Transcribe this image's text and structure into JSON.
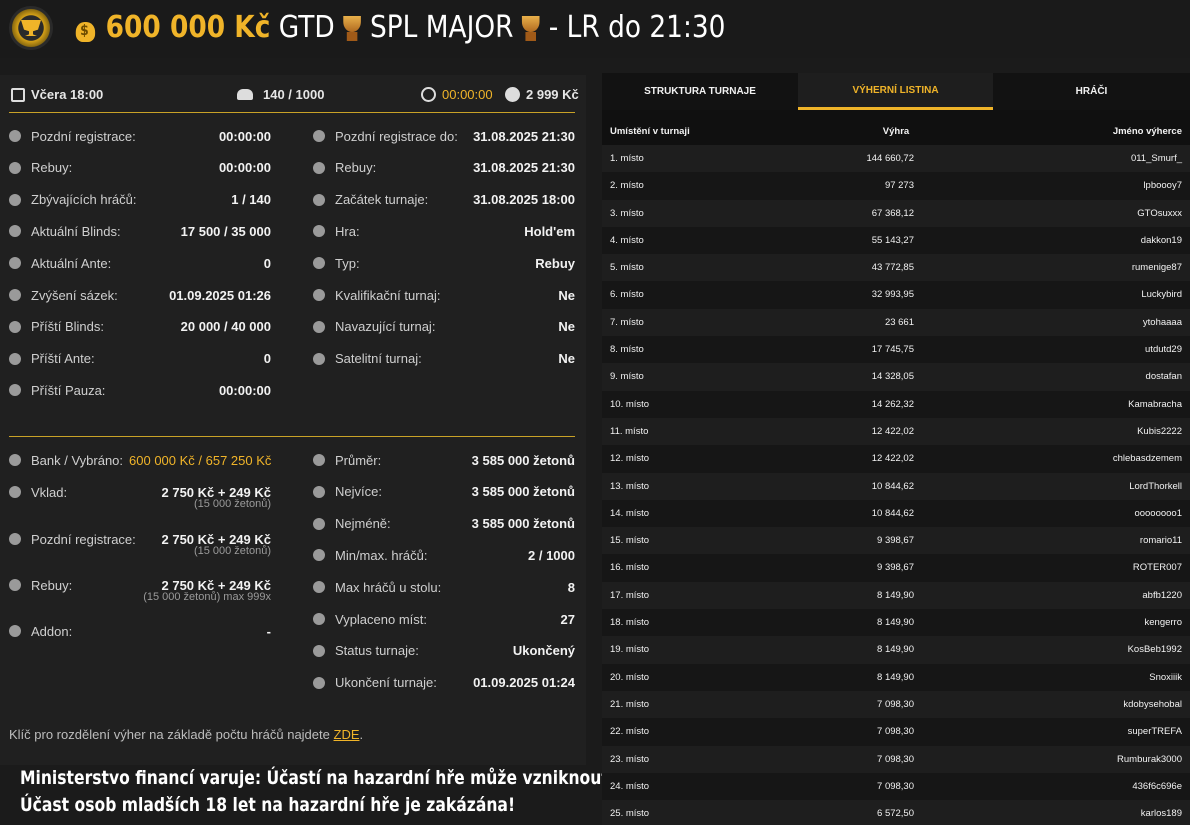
{
  "header": {
    "amount": "600 000 Kč",
    "gtd": "GTD",
    "event": "SPL MAJOR",
    "suffix": "- LR do 21:30"
  },
  "topbar": {
    "date": "Včera 18:00",
    "players": "140 / 1000",
    "timer": "00:00:00",
    "buyin": "2 999 Kč"
  },
  "info_left": [
    {
      "label": "Pozdní registrace:",
      "value": "00:00:00",
      "icon": "user-plus-icon"
    },
    {
      "label": "Rebuy:",
      "value": "00:00:00",
      "icon": "chips-icon"
    },
    {
      "label": "Zbývajících hráčů:",
      "value": "1 / 140",
      "icon": "users-icon"
    },
    {
      "label": "Aktuální Blinds:",
      "value": "17 500 / 35 000",
      "icon": "blinds-icon"
    },
    {
      "label": "Aktuální Ante:",
      "value": "0",
      "icon": "ante-icon"
    },
    {
      "label": "Zvýšení sázek:",
      "value": "01.09.2025 01:26",
      "icon": "level-up-icon"
    },
    {
      "label": "Příští Blinds:",
      "value": "20 000 / 40 000",
      "icon": "blinds-icon"
    },
    {
      "label": "Příští Ante:",
      "value": "0",
      "icon": "ante-icon"
    },
    {
      "label": "Příští Pauza:",
      "value": "00:00:00",
      "icon": "clock-icon"
    }
  ],
  "info_right": [
    {
      "label": "Pozdní registrace do:",
      "value": "31.08.2025 21:30",
      "icon": "user-plus-icon"
    },
    {
      "label": "Rebuy:",
      "value": "31.08.2025 21:30",
      "icon": "chips-icon"
    },
    {
      "label": "Začátek turnaje:",
      "value": "31.08.2025 18:00",
      "icon": "flag-icon"
    },
    {
      "label": "Hra:",
      "value": "Hold'em",
      "icon": "cards-icon"
    },
    {
      "label": "Typ:",
      "value": "Rebuy",
      "icon": "type-icon"
    },
    {
      "label": "Kvalifikační turnaj:",
      "value": "Ne",
      "icon": "medal-icon"
    },
    {
      "label": "Navazující turnaj:",
      "value": "Ne",
      "icon": "medal-icon"
    },
    {
      "label": "Satelitní turnaj:",
      "value": "Ne",
      "icon": "medal-icon"
    }
  ],
  "bank_left": [
    {
      "label": "Bank / Vybráno:",
      "value": "600 000 Kč / 657 250 Kč",
      "sub": "",
      "icon": "money-bag-icon"
    },
    {
      "label": "Vklad:",
      "value": "2 750 Kč + 249 Kč",
      "sub": "(15 000 žetonů)",
      "icon": "chips-icon"
    },
    {
      "label": "Pozdní registrace:",
      "value": "2 750 Kč + 249 Kč",
      "sub": "(15 000 žetonů)",
      "icon": "coin-icon"
    },
    {
      "label": "Rebuy:",
      "value": "2 750 Kč + 249 Kč",
      "sub": "(15 000 žetonů) max 999x",
      "icon": "chips-icon"
    },
    {
      "label": "Addon:",
      "value": "-",
      "sub": "",
      "icon": "coin-icon"
    }
  ],
  "bank_right": [
    {
      "label": "Průměr:",
      "value": "3 585 000 žetonů",
      "icon": "chip-icon"
    },
    {
      "label": "Nejvíce:",
      "value": "3 585 000 žetonů",
      "icon": "chip-up-icon"
    },
    {
      "label": "Nejméně:",
      "value": "3 585 000 žetonů",
      "icon": "chip-down-icon"
    },
    {
      "label": "Min/max. hráčů:",
      "value": "2 / 1000",
      "icon": "users-icon"
    },
    {
      "label": "Max hráčů u stolu:",
      "value": "8",
      "icon": "table-icon"
    },
    {
      "label": "Vyplaceno míst:",
      "value": "27",
      "icon": "payout-icon"
    },
    {
      "label": "Status turnaje:",
      "value": "Ukončený",
      "icon": "info-icon"
    },
    {
      "label": "Ukončení turnaje:",
      "value": "01.09.2025 01:24",
      "icon": "flag-icon"
    }
  ],
  "note": {
    "text": "Klíč pro rozdělení výher na základě počtu hráčů najdete",
    "link": "ZDE",
    "end": "."
  },
  "warning": {
    "line1": "Ministerstvo financí varuje: Účastí na hazardní hře může vzniknout závislost!",
    "line2": "Účast osob mladších 18 let na hazardní hře je zakázána!"
  },
  "tabs": [
    "STRUKTURA TURNAJE",
    "VÝHERNÍ LISTINA",
    "HRÁČI"
  ],
  "table": {
    "headers": [
      "Umístění v turnaji",
      "Výhra",
      "Jméno výherce"
    ],
    "rows": [
      [
        "1. místo",
        "144 660,72",
        "011_Smurf_"
      ],
      [
        "2. místo",
        "97 273",
        "lpboooy7"
      ],
      [
        "3. místo",
        "67 368,12",
        "GTOsuxxx"
      ],
      [
        "4. místo",
        "55 143,27",
        "dakkon19"
      ],
      [
        "5. místo",
        "43 772,85",
        "rumenige87"
      ],
      [
        "6. místo",
        "32 993,95",
        "Luckybird"
      ],
      [
        "7. místo",
        "23 661",
        "ytohaaaa"
      ],
      [
        "8. místo",
        "17 745,75",
        "utdutd29"
      ],
      [
        "9. místo",
        "14 328,05",
        "dostafan"
      ],
      [
        "10. místo",
        "14 262,32",
        "Kamabracha"
      ],
      [
        "11. místo",
        "12 422,02",
        "Kubis2222"
      ],
      [
        "12. místo",
        "12 422,02",
        "chlebasdzemem"
      ],
      [
        "13. místo",
        "10 844,62",
        "LordThorkell"
      ],
      [
        "14. místo",
        "10 844,62",
        "oooooooo1"
      ],
      [
        "15. místo",
        "9 398,67",
        "romario11"
      ],
      [
        "16. místo",
        "9 398,67",
        "ROTER007"
      ],
      [
        "17. místo",
        "8 149,90",
        "abfb1220"
      ],
      [
        "18. místo",
        "8 149,90",
        "kengerro"
      ],
      [
        "19. místo",
        "8 149,90",
        "KosBeb1992"
      ],
      [
        "20. místo",
        "8 149,90",
        "Snoxiiik"
      ],
      [
        "21. místo",
        "7 098,30",
        "kdobysehobal"
      ],
      [
        "22. místo",
        "7 098,30",
        "superTREFA"
      ],
      [
        "23. místo",
        "7 098,30",
        "Rumburak3000"
      ],
      [
        "24. místo",
        "7 098,30",
        "436f6c696e"
      ],
      [
        "25. místo",
        "6 572,50",
        "karlos189"
      ]
    ]
  },
  "colors": {
    "accent": "#f0b429",
    "panel": "#202020",
    "row_a": "#1e1e1e",
    "row_b": "#161616"
  }
}
